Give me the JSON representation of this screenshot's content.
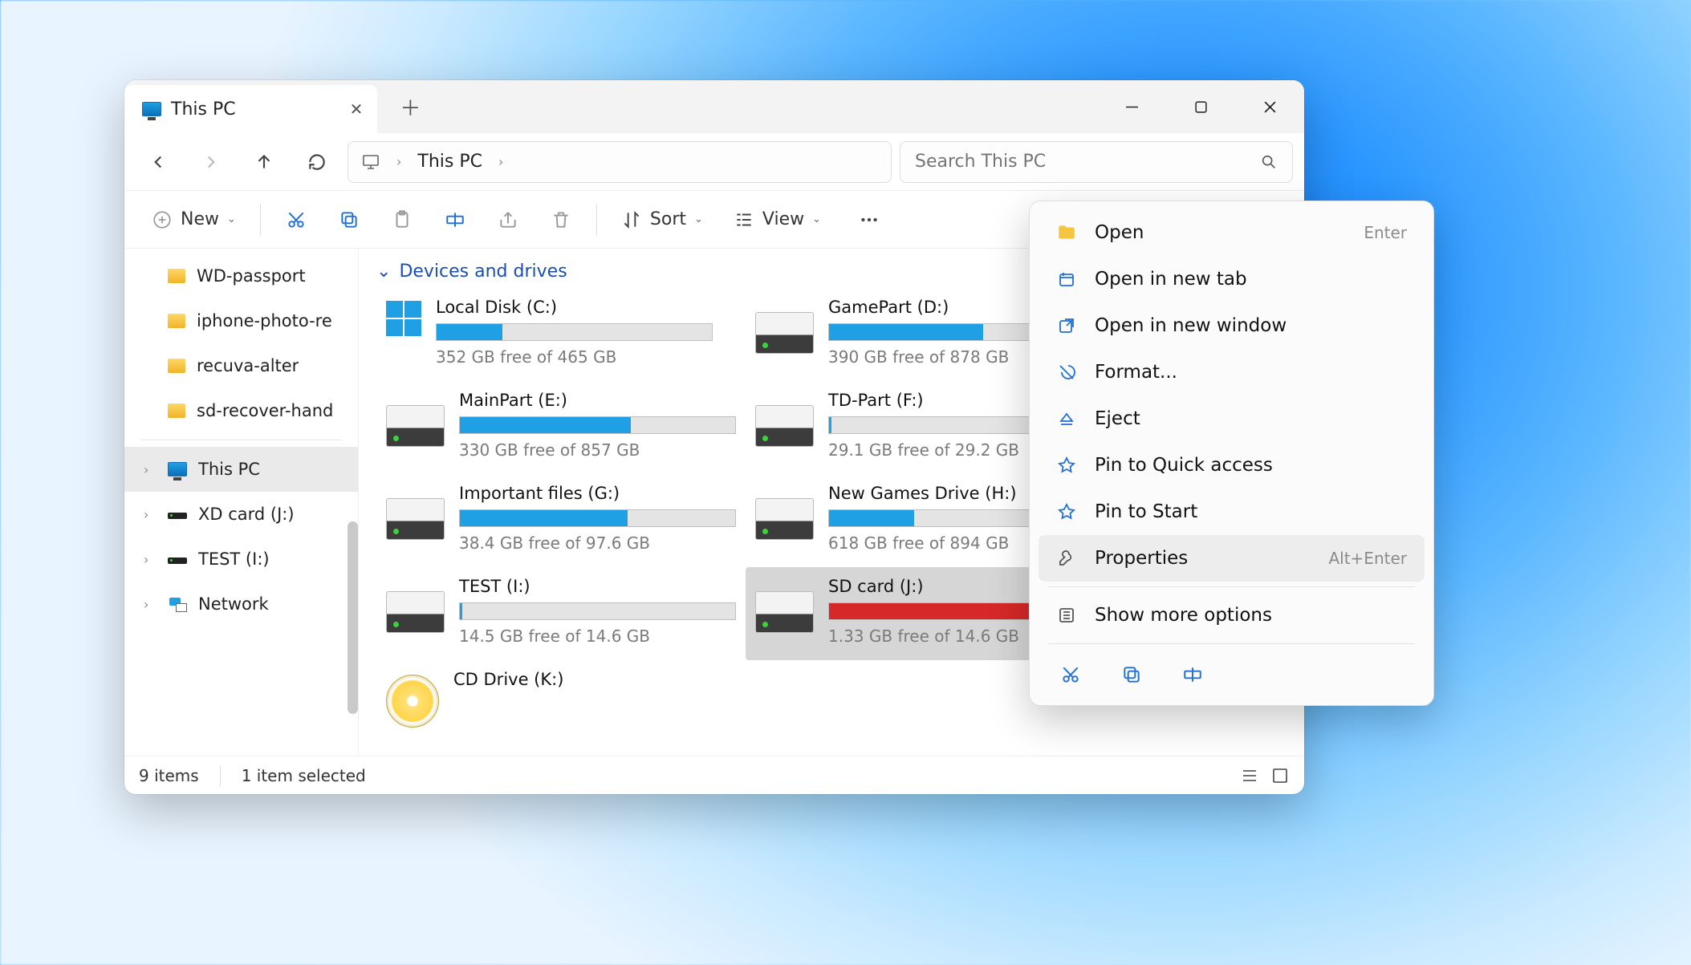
{
  "titlebar": {
    "tab_title": "This PC"
  },
  "nav": {
    "breadcrumb": "This PC"
  },
  "search": {
    "placeholder": "Search This PC"
  },
  "toolbar": {
    "new": "New",
    "sort": "Sort",
    "view": "View"
  },
  "sidebar": {
    "quick": [
      {
        "label": "WD-passport"
      },
      {
        "label": "iphone-photo-re"
      },
      {
        "label": "recuva-alter"
      },
      {
        "label": "sd-recover-hand"
      }
    ],
    "tree": [
      {
        "label": "This PC",
        "icon": "pc",
        "selected": true
      },
      {
        "label": "XD card (J:)",
        "icon": "storage"
      },
      {
        "label": "TEST (I:)",
        "icon": "storage"
      },
      {
        "label": "Network",
        "icon": "network"
      }
    ]
  },
  "main": {
    "group_title": "Devices and drives",
    "drives": [
      {
        "name": "Local Disk (C:)",
        "free": "352 GB free of 465 GB",
        "fill_pct": 24,
        "icon": "winlogo",
        "color": "blue"
      },
      {
        "name": "GamePart (D:)",
        "free": "390 GB free of 878 GB",
        "fill_pct": 56,
        "icon": "drive",
        "color": "blue"
      },
      {
        "name": "MainPart (E:)",
        "free": "330 GB free of 857 GB",
        "fill_pct": 62,
        "icon": "drive",
        "color": "blue"
      },
      {
        "name": "TD-Part (F:)",
        "free": "29.1 GB free of 29.2 GB",
        "fill_pct": 1,
        "icon": "drive",
        "color": "blue"
      },
      {
        "name": "Important files (G:)",
        "free": "38.4 GB free of 97.6 GB",
        "fill_pct": 61,
        "icon": "drive",
        "color": "blue"
      },
      {
        "name": "New Games Drive (H:)",
        "free": "618 GB free of 894 GB",
        "fill_pct": 31,
        "icon": "drive",
        "color": "blue"
      },
      {
        "name": "TEST (I:)",
        "free": "14.5 GB free of 14.6 GB",
        "fill_pct": 1,
        "icon": "drive",
        "color": "blue"
      },
      {
        "name": "SD card (J:)",
        "free": "1.33 GB free of 14.6 GB",
        "fill_pct": 91,
        "icon": "drive",
        "color": "red",
        "selected": true
      },
      {
        "name": "CD Drive (K:)",
        "free": "",
        "fill_pct": -1,
        "icon": "cd"
      }
    ]
  },
  "statusbar": {
    "items": "9 items",
    "selected": "1 item selected"
  },
  "context_menu": {
    "items": [
      {
        "label": "Open",
        "kbd": "Enter",
        "icon": "folder"
      },
      {
        "label": "Open in new tab",
        "kbd": "",
        "icon": "newtab"
      },
      {
        "label": "Open in new window",
        "kbd": "",
        "icon": "newwin"
      },
      {
        "label": "Format...",
        "kbd": "",
        "icon": "format"
      },
      {
        "label": "Eject",
        "kbd": "",
        "icon": "eject"
      },
      {
        "label": "Pin to Quick access",
        "kbd": "",
        "icon": "pin"
      },
      {
        "label": "Pin to Start",
        "kbd": "",
        "icon": "pin"
      },
      {
        "label": "Properties",
        "kbd": "Alt+Enter",
        "icon": "wrench",
        "hover": true
      },
      {
        "label": "Show more options",
        "kbd": "",
        "icon": "more"
      }
    ]
  }
}
